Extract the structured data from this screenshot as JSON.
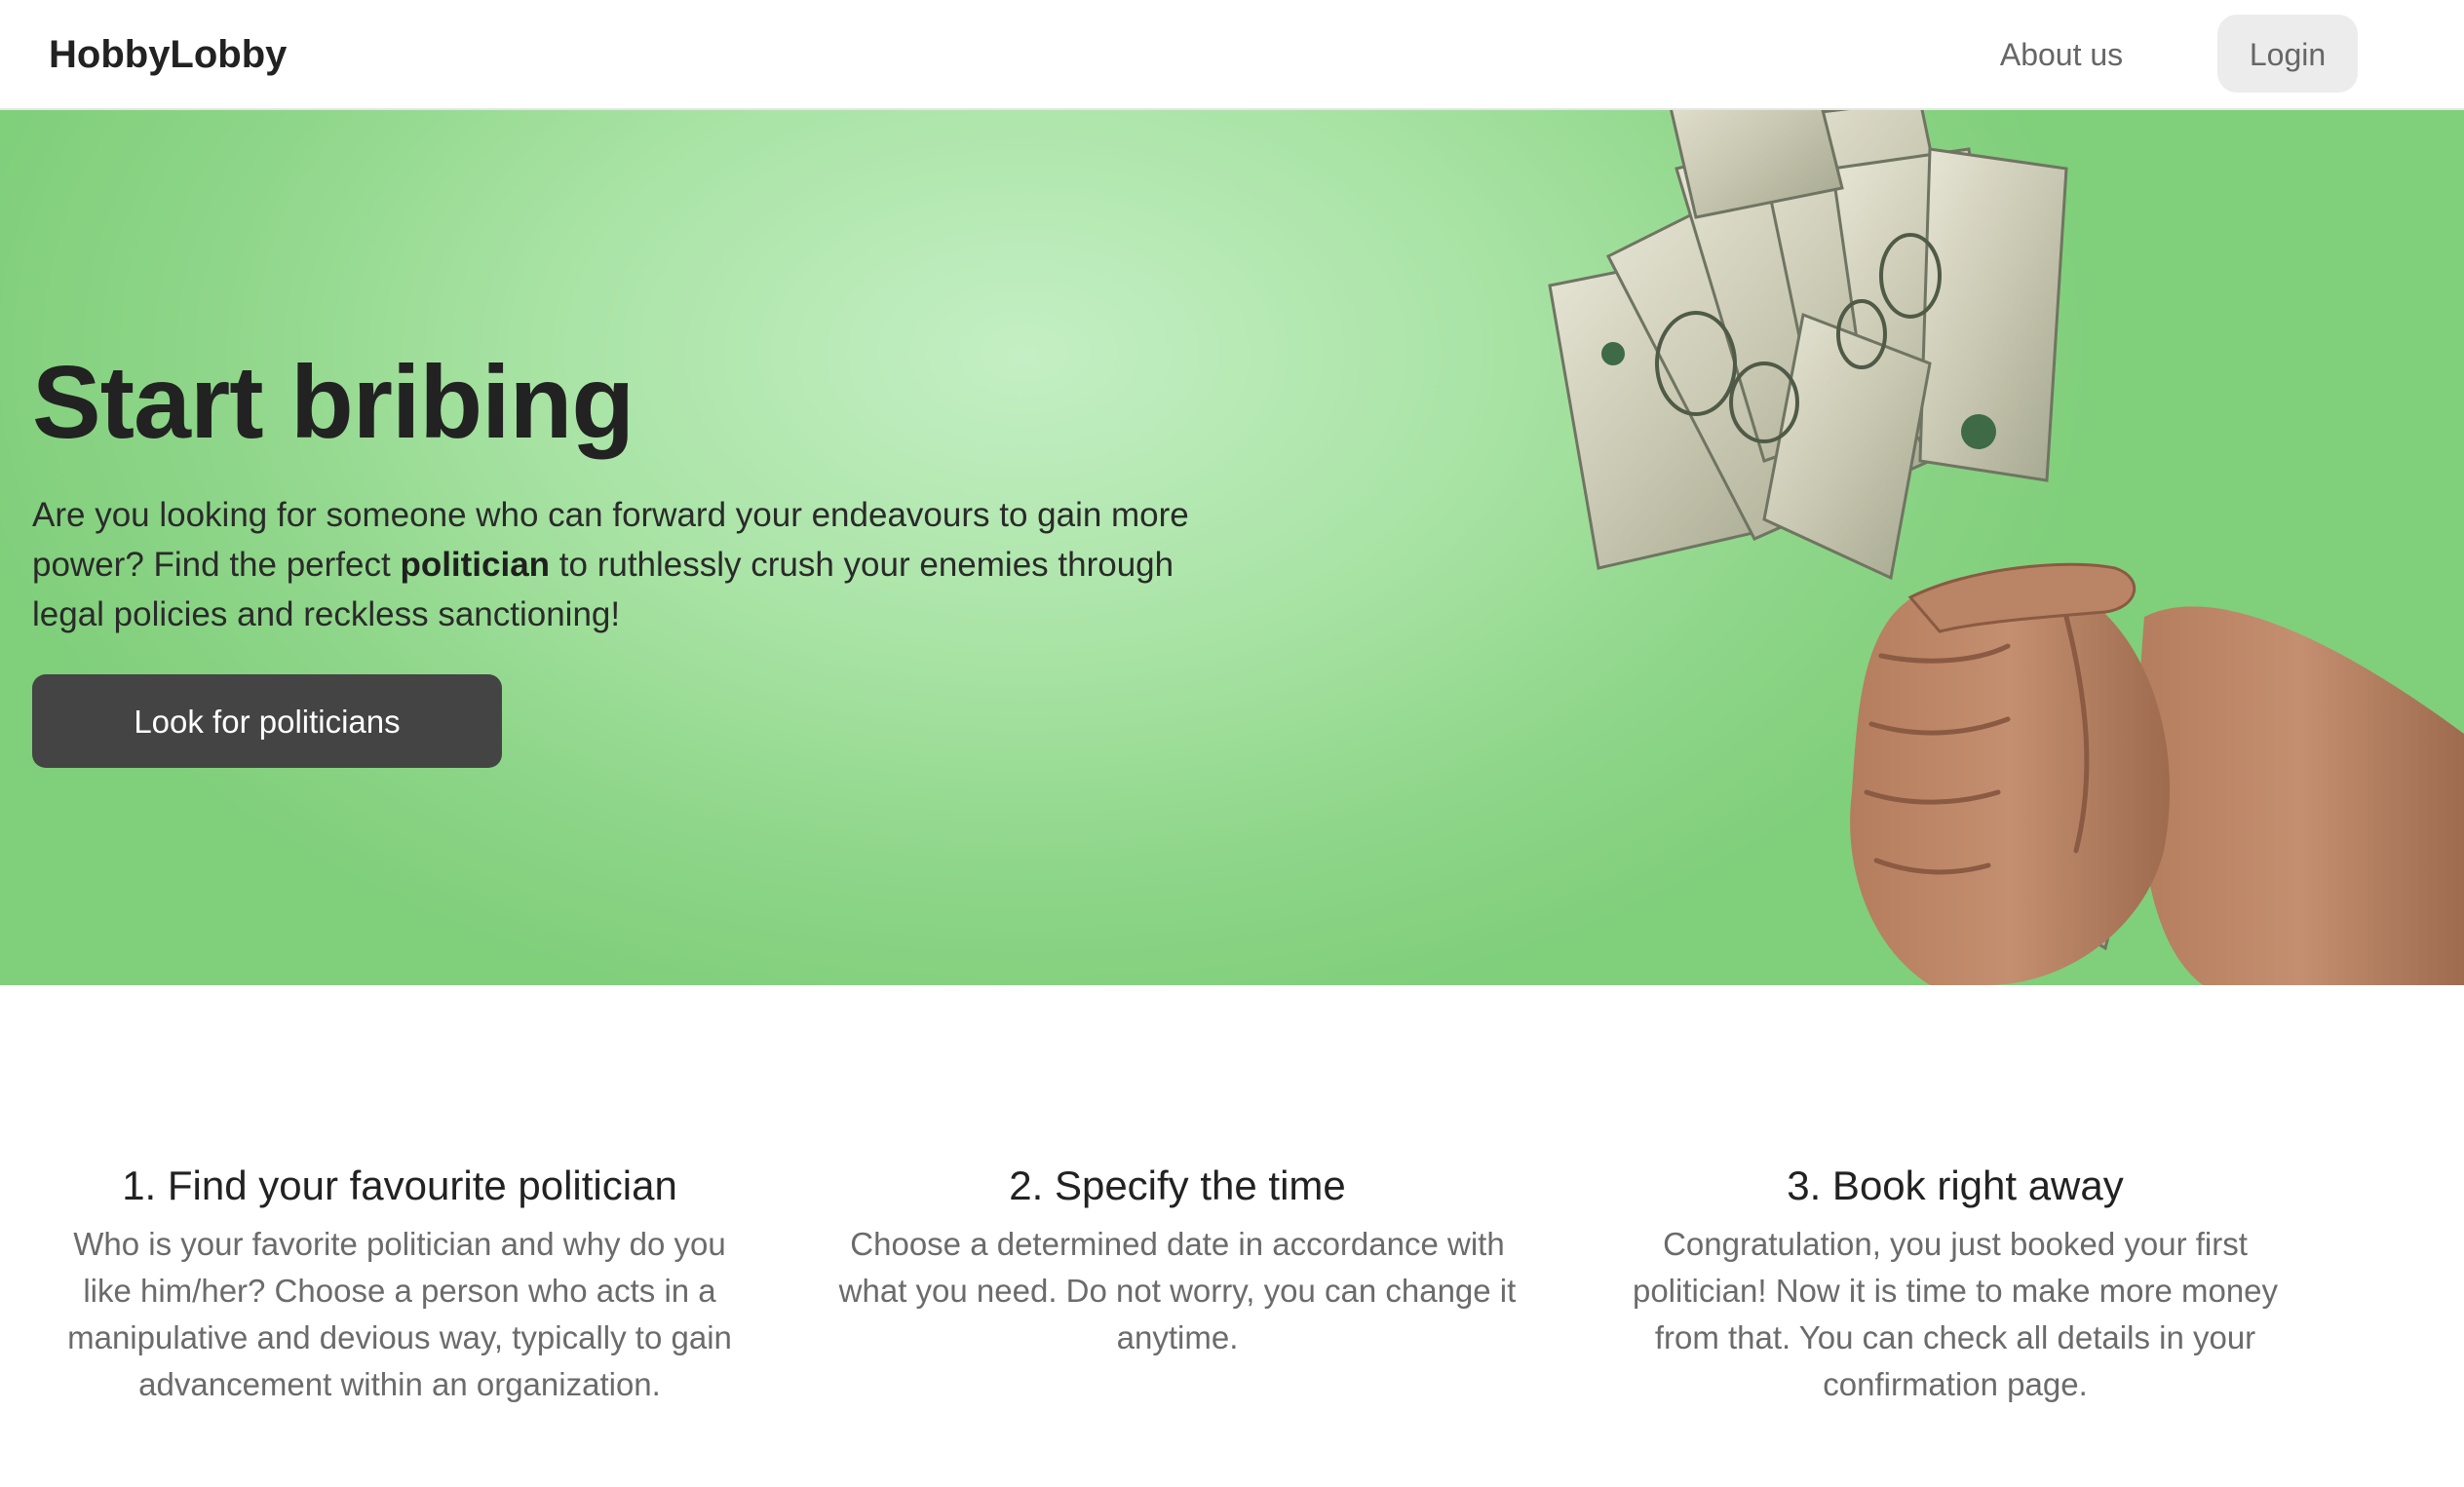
{
  "navbar": {
    "brand": "HobbyLobby",
    "links": [
      {
        "label": "About us"
      }
    ],
    "login_label": "Login"
  },
  "hero": {
    "title": "Start bribing",
    "text_before": "Are you looking for someone who can forward your endeavours to gain more power? Find the perfect ",
    "text_bold": "politician",
    "text_after": " to ruthlessly crush your enemies through legal policies and reckless sanctioning!",
    "cta_label": "Look for politicians",
    "image_icon": "fist-with-dollar-bills"
  },
  "steps": [
    {
      "title": "1. Find your favourite politician",
      "text": "Who is your favorite politician and why do you like him/her? Choose a person who acts in a manipulative and devious way, typically to gain advancement within an organization."
    },
    {
      "title": "2. Specify the time",
      "text": "Choose a determined date in accordance with what you need. Do not worry, you can change it anytime."
    },
    {
      "title": "3. Book right away",
      "text": "Congratulation, you just booked your first politician! Now it is time to make more money from that. You can check all details in your confirmation page."
    }
  ],
  "colors": {
    "hero_bg": "#a8e3a4",
    "cta_bg": "#444444",
    "login_bg": "#ececec"
  }
}
